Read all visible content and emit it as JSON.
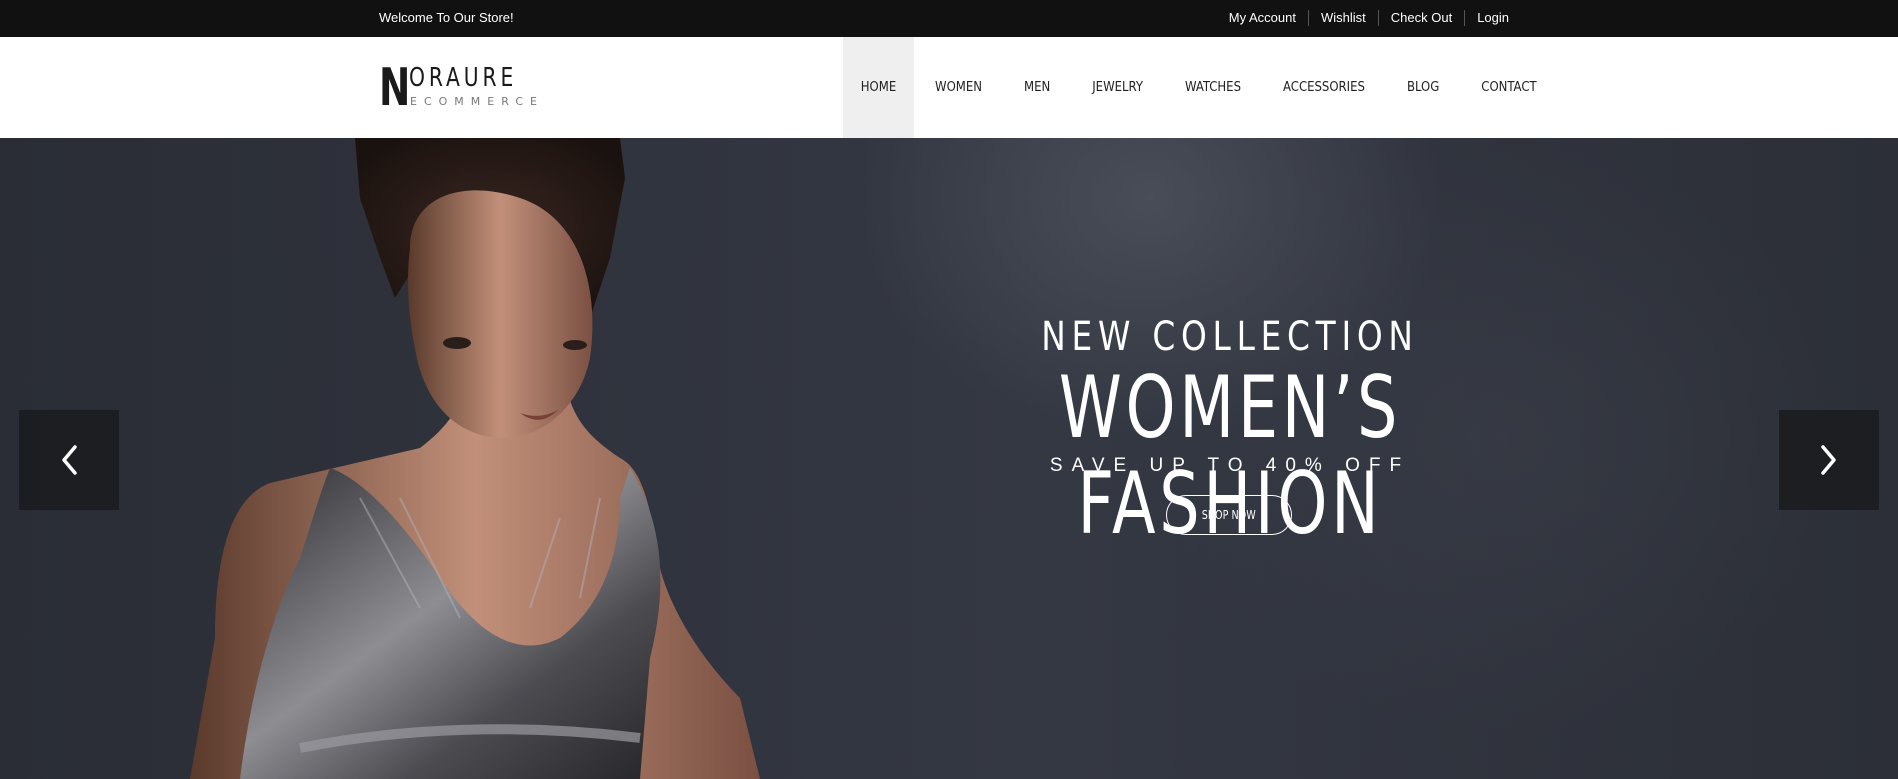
{
  "topbar": {
    "welcome": "Welcome To Our Store!",
    "links": [
      "My Account",
      "Wishlist",
      "Check Out",
      "Login"
    ]
  },
  "logo": {
    "initial": "N",
    "word": "ORAURE",
    "tagline": "ECOMMERCE"
  },
  "nav": {
    "items": [
      "HOME",
      "WOMEN",
      "MEN",
      "JEWELRY",
      "WATCHES",
      "ACCESSORIES",
      "BLOG",
      "CONTACT"
    ],
    "active": "HOME"
  },
  "hero": {
    "kicker": "NEW COLLECTION",
    "headline": "WOMEN’S FASHION",
    "subline": "SAVE UP TO 40% OFF",
    "button": "SHOP NOW",
    "prev_icon": "chevron-left-icon",
    "next_icon": "chevron-right-icon"
  },
  "colors": {
    "topbar_bg": "#111111",
    "header_bg": "#ffffff",
    "nav_active_bg": "#efefef",
    "hero_bg": "#2f333c",
    "text_light": "#ffffff"
  }
}
